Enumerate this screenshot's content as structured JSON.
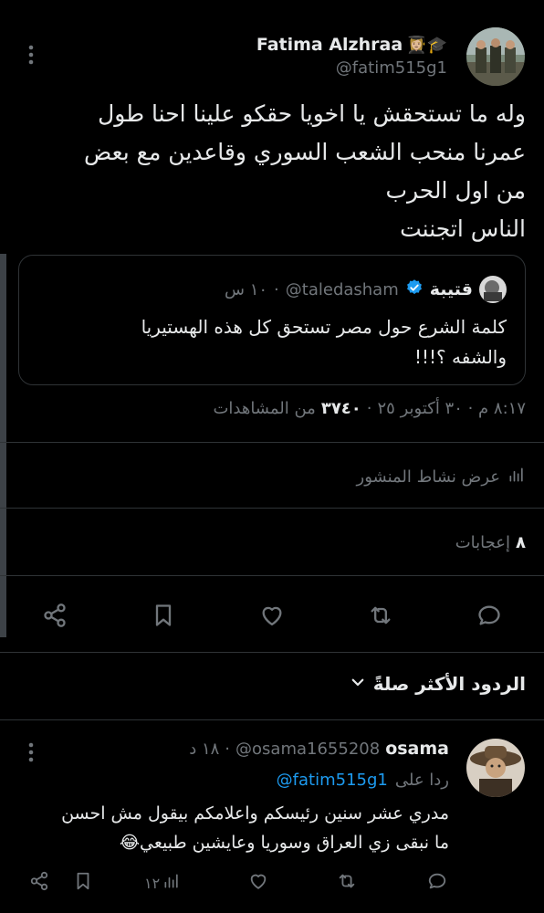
{
  "tweet": {
    "author_name": "Fatima Alzhraa",
    "author_emoji": "👩🏼‍🎓🎓",
    "author_handle": "@fatim515g1",
    "body_lines": [
      "وله ما تستحقش يا اخويا حقكو علينا احنا طول",
      "عمرنا منحب الشعب السوري وقاعدين مع بعض",
      "من اول الحرب",
      "الناس اتجننت"
    ],
    "quote": {
      "name": "قتيبة",
      "handle": "@taledasham",
      "time": "١٠ س",
      "text_lines": [
        "كلمة الشرع حول مصر تستحق كل هذه الهستيريا",
        "والشفه ؟!!!"
      ]
    },
    "timestamp": "٨:١٧ م · ٣٠ أكتوبر ٢٥",
    "views_count": "٣٧٤٠",
    "views_label": "من المشاهدات",
    "activity_label": "عرض نشاط المنشور",
    "likes_count": "٨",
    "likes_label": "إعجابات"
  },
  "replies_section": {
    "title": "الردود الأكثر صلةً"
  },
  "reply": {
    "author_name": "osama",
    "author_handle": "@osama1655208",
    "time": "١٨ د",
    "replying_to_label": "ردا على",
    "replying_to_handle": "@fatim515g1",
    "body_lines": [
      "مدري عشر سنين رئيسكم واعلامكم بيقول مش احسن",
      "ما نبقى زي العراق وسوريا وعايشين طبيعي😂"
    ],
    "views": "١٢"
  },
  "colors": {
    "background": "#000000",
    "text": "#e7e9ea",
    "muted": "#71767b",
    "accent": "#1d9bf0",
    "border": "#2f3336"
  },
  "icons": [
    "more-icon",
    "share-icon",
    "bookmark-icon",
    "like-icon",
    "retweet-icon",
    "reply-icon",
    "analytics-icon",
    "verified-icon",
    "chevron-down-icon"
  ]
}
